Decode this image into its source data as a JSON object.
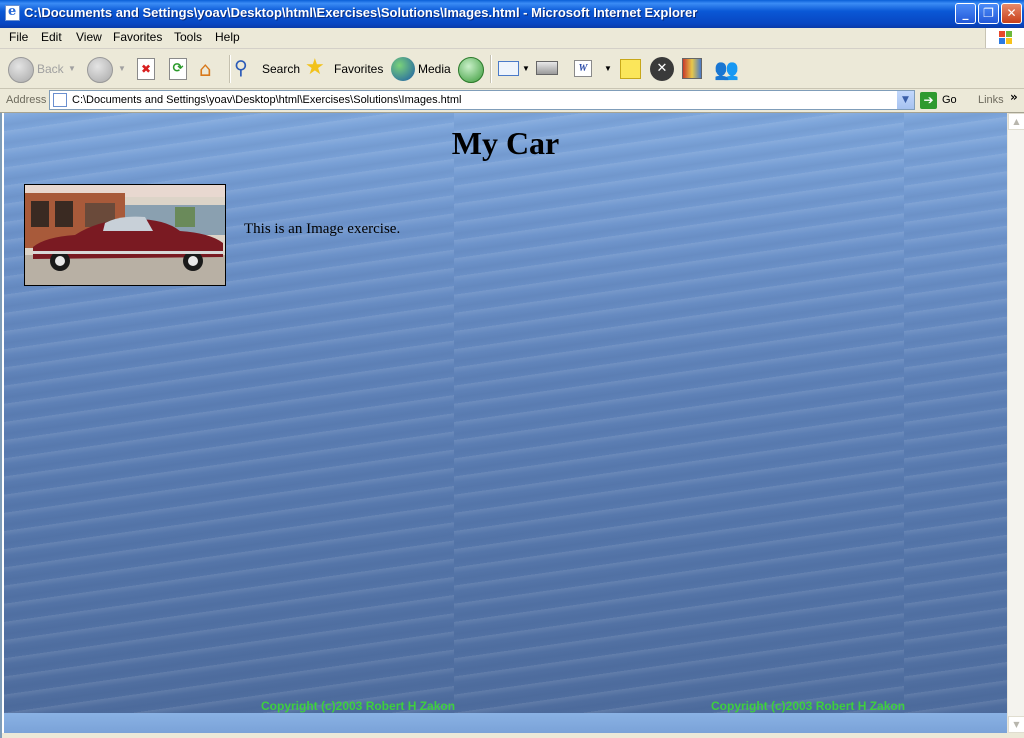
{
  "window": {
    "title": "C:\\Documents and Settings\\yoav\\Desktop\\html\\Exercises\\Solutions\\Images.html - Microsoft Internet Explorer",
    "minimize_glyph": "_",
    "restore_glyph": "❐",
    "close_glyph": "✕"
  },
  "menu": {
    "items": [
      "File",
      "Edit",
      "View",
      "Favorites",
      "Tools",
      "Help"
    ]
  },
  "toolbar": {
    "back_label": "Back",
    "search_label": "Search",
    "favorites_label": "Favorites",
    "media_label": "Media"
  },
  "address": {
    "label": "Address",
    "url": "C:\\Documents and Settings\\yoav\\Desktop\\html\\Exercises\\Solutions\\Images.html",
    "go_label": "Go",
    "links_label": "Links"
  },
  "page": {
    "heading": "My Car",
    "body_text": "This is an Image exercise.",
    "copyright_left": "Copyright (c)2003 Robert H Zakon",
    "copyright_right": "Copyright (c)2003 Robert H Zakon",
    "car_color": "#7a1a22",
    "copyright_color": "#3ecf3e"
  }
}
